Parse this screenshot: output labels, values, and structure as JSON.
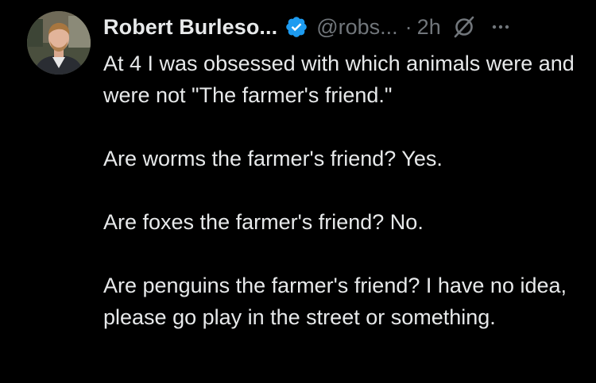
{
  "tweet": {
    "author": {
      "display_name": "Robert Burleso...",
      "handle": "@robs...",
      "verified": true,
      "avatar_icon": "avatar-photo"
    },
    "separator": "·",
    "time": "2h",
    "icons": {
      "verified": "verified-badge-icon",
      "grok": "grok-icon",
      "more": "more-icon"
    },
    "paragraphs": [
      "At 4 I was obsessed with which animals were and were not \"The farmer's friend.\"",
      "Are worms the farmer's friend? Yes.",
      "Are foxes the farmer's friend? No.",
      "Are penguins the farmer's friend? I have no idea, please go play in the street or something."
    ]
  },
  "colors": {
    "background": "#000000",
    "text_primary": "#e7e9ea",
    "text_secondary": "#71767b",
    "verified_blue": "#1d9bf0"
  }
}
